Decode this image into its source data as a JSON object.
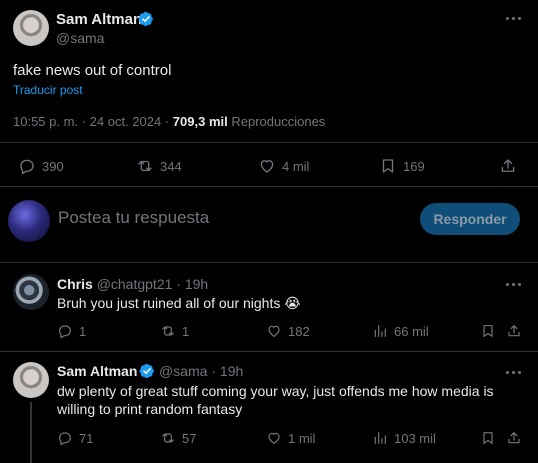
{
  "tweet": {
    "author_name": "Sam Altman",
    "handle": "@sama",
    "text": "fake news out of control",
    "translate_link": "Traducir post",
    "time": "10:55 p. m.",
    "separator": "·",
    "date": "24 oct. 2024",
    "views": "709,3 mil",
    "views_label": "Reproducciones",
    "replies": "390",
    "reposts": "344",
    "likes": "4 mil",
    "bookmarks": "169"
  },
  "composer": {
    "placeholder": "Postea tu respuesta",
    "reply_button": "Responder"
  },
  "replies": [
    {
      "author_name": "Chris",
      "handle": "@chatgpt21",
      "dot": "·",
      "time": "19h",
      "text": "Bruh you just ruined all of our nights 😭",
      "replies": "1",
      "reposts": "1",
      "likes": "182",
      "views": "66 mil"
    },
    {
      "author_name": "Sam Altman",
      "handle": "@sama",
      "dot": "·",
      "time": "19h",
      "text_line1": "dw plenty of great stuff coming your way, just offends me how media is",
      "text_line2": "willing to print random fantasy",
      "replies": "71",
      "reposts": "57",
      "likes": "1 mil",
      "views": "103 mil"
    }
  ],
  "colors": {
    "accent": "#1d9bf0",
    "button_bg": "#0f4e78",
    "text": "#e7e9ea",
    "muted": "#71767b",
    "divider": "#2f3336"
  }
}
